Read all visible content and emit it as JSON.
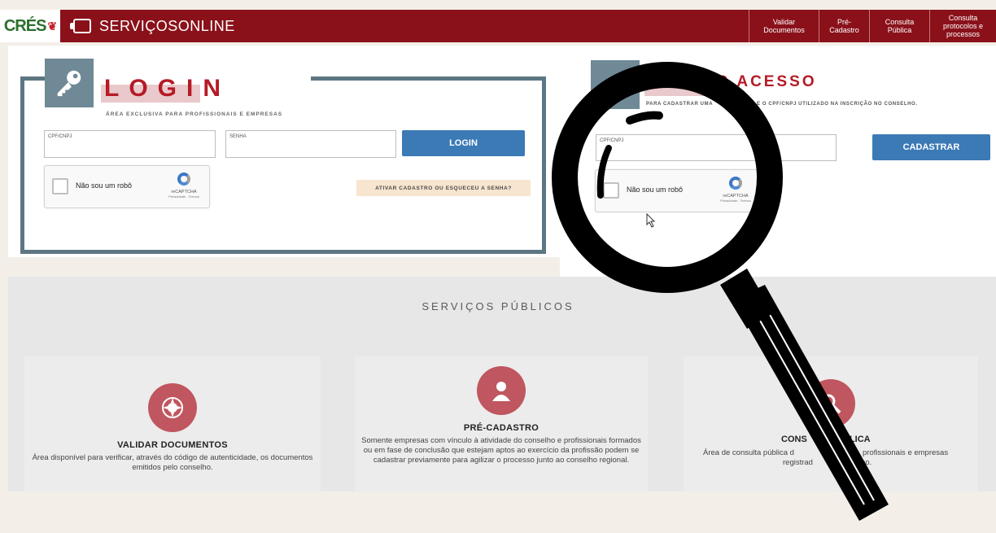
{
  "header": {
    "logo_text": "CRÉS",
    "brand": "SERVIÇOSONLINE",
    "nav": [
      "Validar Documentos",
      "Pré-Cadastro",
      "Consulta Pública",
      "Consulta protocolos e processos"
    ]
  },
  "login": {
    "title": "LOGIN",
    "subtitle": "ÁREA EXCLUSIVA PARA PROFISSIONAIS E EMPRESAS",
    "cpf_label": "CPF/CNPJ",
    "senha_label": "SENHA",
    "button": "LOGIN",
    "captcha_text": "Não sou um robô",
    "captcha_brand": "reCAPTCHA",
    "captcha_links": "Privacidade - Termos",
    "ativar": "ATIVAR CADASTRO OU ESQUECEU A SENHA?"
  },
  "primeiro": {
    "title": "O ACESSO",
    "subtitle": "PARA CADASTRAR UMA",
    "subtitle_right": "E O CPF/CNPJ UTILIZADO NA INSCRIÇÃO NO CONSELHO.",
    "cpf_label": "CPF/CNPJ",
    "button": "CADASTRAR",
    "captcha_text": "Não sou um robô",
    "captcha_brand": "reCAPTCHA",
    "captcha_links": "Privacidade - Termos"
  },
  "servicos": {
    "title": "SERVIÇOS PÚBLICOS",
    "cards": [
      {
        "title": "VALIDAR DOCUMENTOS",
        "text": "Área disponível para verificar, através do código de autenticidade, os documentos emitidos pelo conselho."
      },
      {
        "title": "PRÉ-CADASTRO",
        "text": "Somente empresas com vínculo à atividade do conselho e profissionais formados ou em fase de conclusão que estejam aptos ao exercício da profissão podem se cadastrar previamente para agilizar o processo junto ao conselho regional."
      },
      {
        "title_left": "CONS",
        "title_right": "BLICA",
        "text_left": "Área de consulta pública d",
        "text_right": "profissionais e empresas",
        "text_line2_left": "registrad",
        "text_line2_right": "lho."
      }
    ]
  },
  "colors": {
    "brand_red": "#8a111a",
    "accent_red": "#b51a26",
    "button_blue": "#3b7ab5",
    "slate": "#5d7683"
  }
}
